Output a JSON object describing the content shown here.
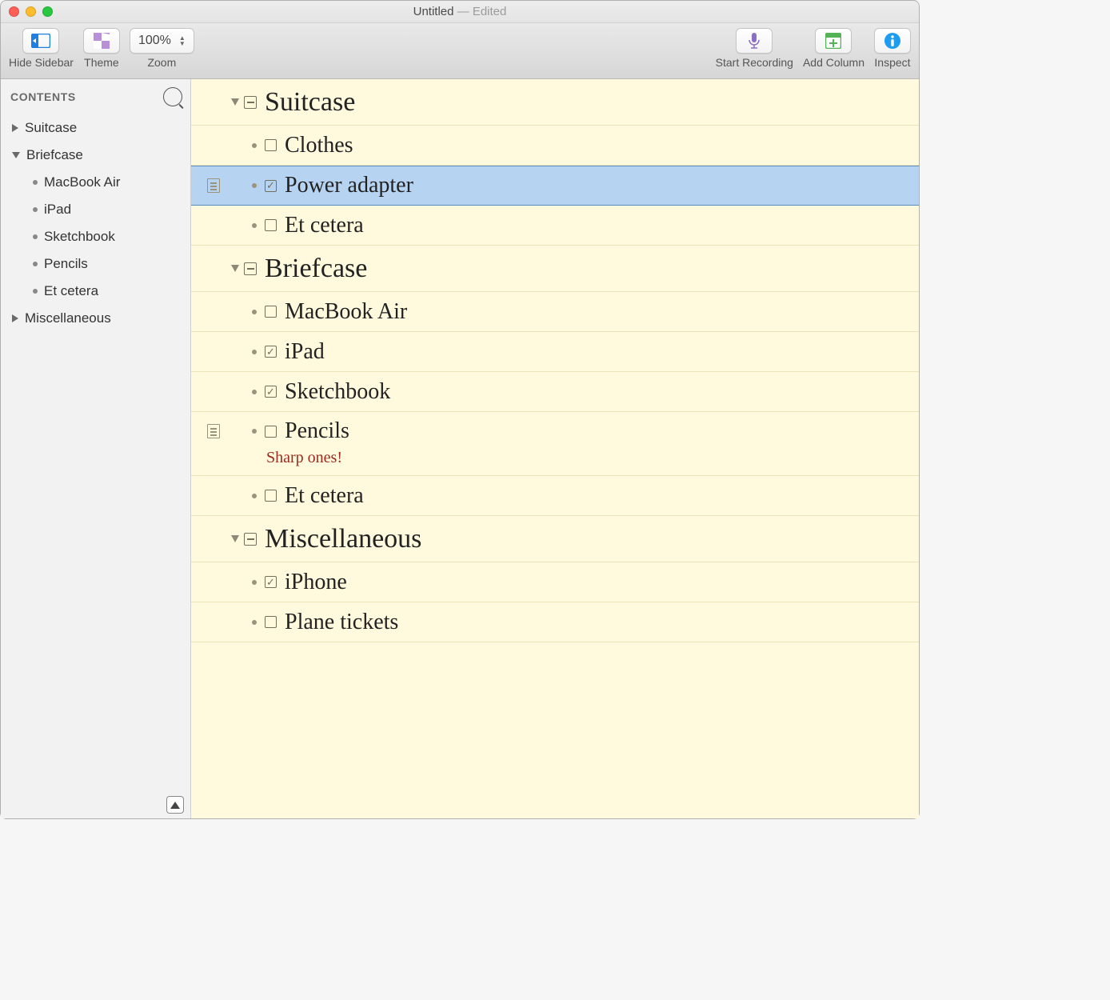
{
  "window": {
    "title": "Untitled",
    "edited_suffix": "— Edited"
  },
  "toolbar": {
    "hide_sidebar": "Hide Sidebar",
    "theme": "Theme",
    "zoom_label": "Zoom",
    "zoom_value": "100%",
    "start_recording": "Start Recording",
    "add_column": "Add Column",
    "inspect": "Inspect"
  },
  "sidebar": {
    "title": "CONTENTS",
    "items": [
      {
        "label": "Suitcase",
        "expanded": false
      },
      {
        "label": "Briefcase",
        "expanded": true,
        "children": [
          {
            "label": "MacBook Air"
          },
          {
            "label": "iPad"
          },
          {
            "label": "Sketchbook"
          },
          {
            "label": "Pencils"
          },
          {
            "label": "Et cetera"
          }
        ]
      },
      {
        "label": "Miscellaneous",
        "expanded": false
      }
    ]
  },
  "outline": {
    "sections": [
      {
        "title": "Suitcase",
        "state": "mixed",
        "items": [
          {
            "label": "Clothes",
            "checked": false
          },
          {
            "label": "Power adapter",
            "checked": true,
            "has_note_icon": true,
            "selected": true
          },
          {
            "label": "Et cetera",
            "checked": false
          }
        ]
      },
      {
        "title": "Briefcase",
        "state": "mixed",
        "items": [
          {
            "label": "MacBook Air",
            "checked": false
          },
          {
            "label": "iPad",
            "checked": true
          },
          {
            "label": "Sketchbook",
            "checked": true
          },
          {
            "label": "Pencils",
            "checked": false,
            "has_note_icon": true,
            "note": "Sharp ones!"
          },
          {
            "label": "Et cetera",
            "checked": false
          }
        ]
      },
      {
        "title": "Miscellaneous",
        "state": "mixed",
        "items": [
          {
            "label": "iPhone",
            "checked": true
          },
          {
            "label": "Plane tickets",
            "checked": false
          }
        ]
      }
    ]
  }
}
